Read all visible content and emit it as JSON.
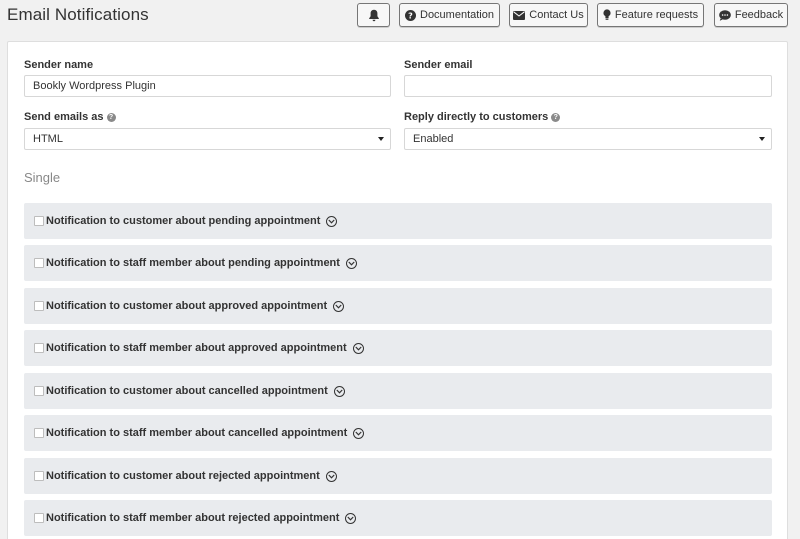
{
  "page": {
    "title": "Email Notifications"
  },
  "toolbar": {
    "notifications_icon": "bell-icon",
    "documentation_label": "Documentation",
    "contact_label": "Contact Us",
    "feature_label": "Feature requests",
    "feedback_label": "Feedback"
  },
  "form": {
    "sender_name_label": "Sender name",
    "sender_name_value": "Bookly Wordpress Plugin",
    "sender_email_label": "Sender email",
    "sender_email_value": "",
    "send_as_label": "Send emails as",
    "send_as_value": "HTML",
    "reply_label": "Reply directly to customers",
    "reply_value": "Enabled"
  },
  "section": {
    "title": "Single"
  },
  "notifications": [
    {
      "label": "Notification to customer about pending appointment"
    },
    {
      "label": "Notification to staff member about pending appointment"
    },
    {
      "label": "Notification to customer about approved appointment"
    },
    {
      "label": "Notification to staff member about approved appointment"
    },
    {
      "label": "Notification to customer about cancelled appointment"
    },
    {
      "label": "Notification to staff member about cancelled appointment"
    },
    {
      "label": "Notification to customer about rejected appointment"
    },
    {
      "label": "Notification to staff member about rejected appointment"
    }
  ],
  "colors": {
    "background": "#f1f1f1",
    "panel": "#ffffff",
    "notification_row": "#e9ebee",
    "help_icon": "#8a8a8a"
  }
}
